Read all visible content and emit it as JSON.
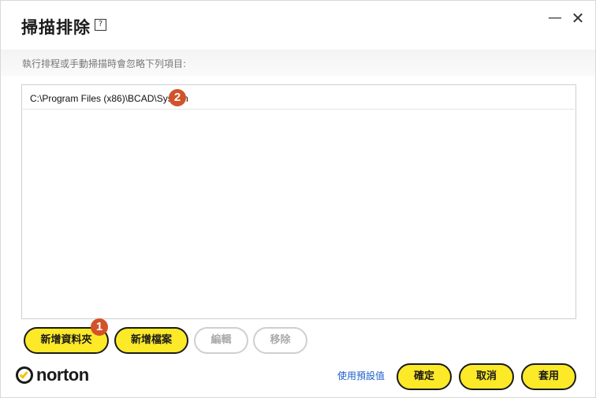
{
  "window": {
    "title": "掃描排除",
    "help_glyph": "?",
    "minimize_glyph": "—",
    "close_glyph": "✕"
  },
  "description": "執行排程或手動掃描時會忽略下列項目:",
  "exclusions": [
    {
      "path": "C:\\Program Files (x86)\\BCAD\\System"
    }
  ],
  "badges": {
    "one": "1",
    "two": "2"
  },
  "buttons": {
    "add_folder": "新增資料夾",
    "add_file": "新增檔案",
    "edit": "編輯",
    "remove": "移除",
    "use_defaults": "使用預設值",
    "ok": "確定",
    "cancel": "取消",
    "apply": "套用"
  },
  "brand": {
    "name": "norton",
    "logo_icon": "norton-check-icon"
  },
  "colors": {
    "accent_yellow": "#fce928",
    "badge_red": "#d2532a",
    "link_blue": "#1a5fc8"
  }
}
